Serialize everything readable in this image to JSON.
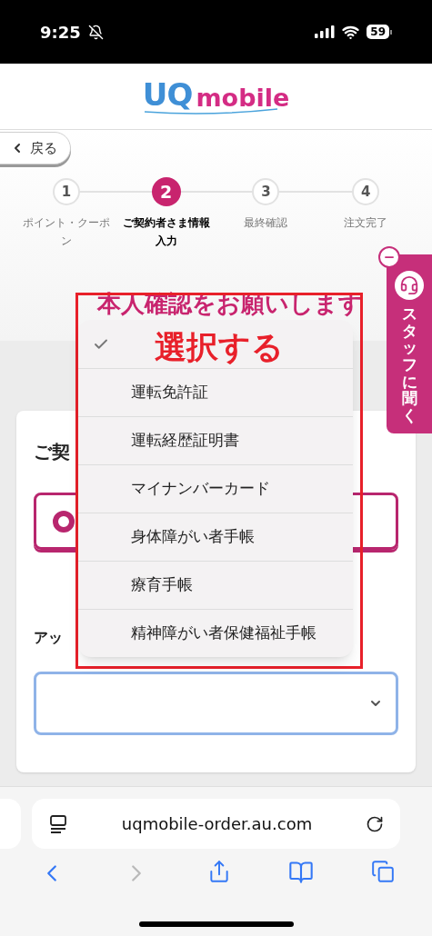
{
  "status_bar": {
    "time": "9:25",
    "battery": "59"
  },
  "header": {
    "logo": {
      "part_1": "UQ",
      "part_2": "mobile"
    }
  },
  "back_button": {
    "label": "戻る"
  },
  "stepper": [
    {
      "number": "1",
      "label": "ポイント・クーポン",
      "selected": false
    },
    {
      "number": "2",
      "label": "ご契約者さま情報入力",
      "selected": true
    },
    {
      "number": "3",
      "label": "最終確認",
      "selected": false
    },
    {
      "number": "4",
      "label": "注文完了",
      "selected": false
    }
  ],
  "heading": "本人確認をお願いします",
  "card": {
    "title": "ご契",
    "option_selected": true,
    "field_label": "アッ"
  },
  "dropdown": {
    "options": [
      {
        "selected": true
      },
      {
        "label": "運転免許証",
        "selected": false
      },
      {
        "label": "運転経歴証明書",
        "selected": false
      },
      {
        "label": "マイナンバーカード",
        "selected": false
      },
      {
        "label": "身体障がい者手帳",
        "selected": false
      },
      {
        "label": "療育手帳",
        "selected": false
      },
      {
        "label": "精神障がい者保健福祉手帳",
        "selected": false
      }
    ]
  },
  "annotation": {
    "text": "選択する"
  },
  "staff_tab": {
    "label": "スタッフに聞く"
  },
  "browser": {
    "url": "uqmobile-order.au.com",
    "back_enabled": true,
    "forward_enabled": false
  }
}
